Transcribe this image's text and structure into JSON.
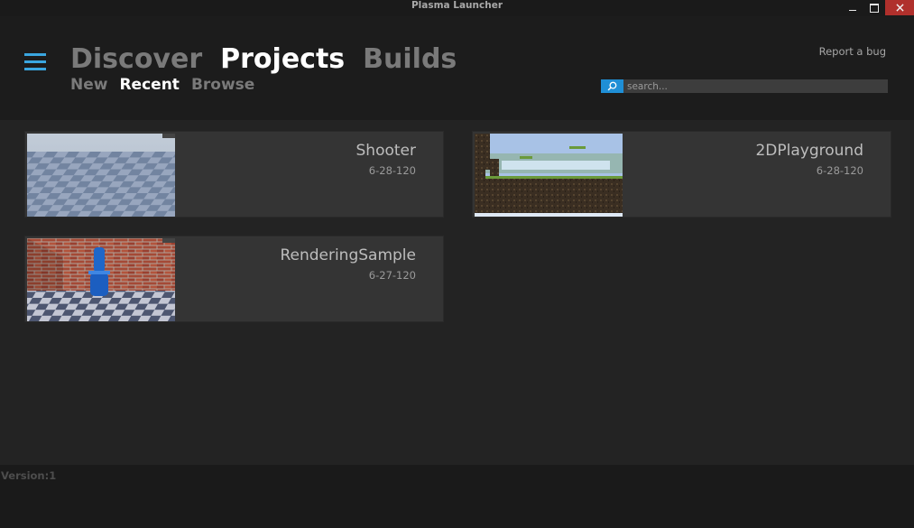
{
  "window": {
    "title": "Plasma Launcher",
    "close_color": "#b0302c"
  },
  "header": {
    "menu_icon": "hamburger-icon",
    "accent": "#3aa6e0",
    "main_nav": [
      {
        "label": "Discover",
        "active": false
      },
      {
        "label": "Projects",
        "active": true
      },
      {
        "label": "Builds",
        "active": false
      }
    ],
    "sub_nav": [
      {
        "label": "New",
        "active": false
      },
      {
        "label": "Recent",
        "active": true
      },
      {
        "label": "Browse",
        "active": false
      }
    ],
    "report_bug": "Report a bug",
    "search": {
      "placeholder": "search...",
      "value": "",
      "icon": "search-icon"
    }
  },
  "projects": [
    {
      "name": "Shooter",
      "date": "6-28-120",
      "thumbnail": "checkerboard-floor"
    },
    {
      "name": "2DPlayground",
      "date": "6-28-120",
      "thumbnail": "platformer-level"
    },
    {
      "name": "RenderingSample",
      "date": "6-27-120",
      "thumbnail": "brick-room-barrels"
    }
  ],
  "footer": {
    "version": "Version:1"
  }
}
